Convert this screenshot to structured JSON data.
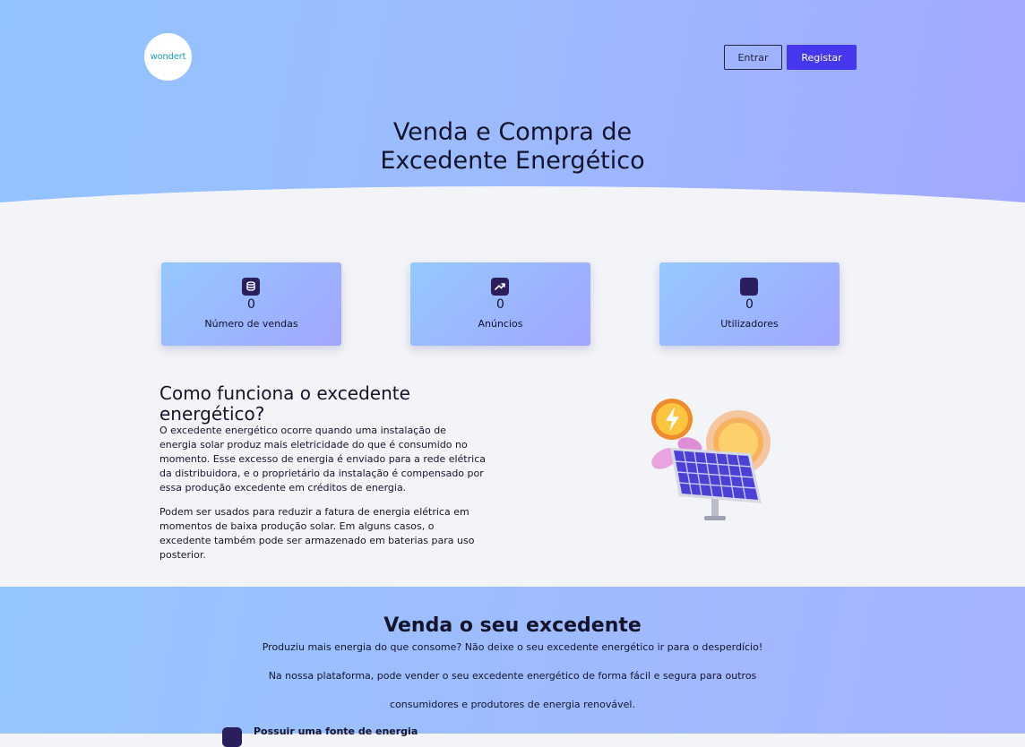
{
  "header": {
    "logo_text": "wondert",
    "login_label": "Entrar",
    "register_label": "Registar"
  },
  "hero": {
    "title_line1": "Venda e Compra de",
    "title_line2": "Excedente Energético"
  },
  "stats": [
    {
      "icon": "coins-icon",
      "value": "0",
      "label": "Número de vendas"
    },
    {
      "icon": "trending-up-icon",
      "value": "0",
      "label": "Anúncios"
    },
    {
      "icon": "users-icon",
      "value": "0",
      "label": "Utilizadores"
    }
  ],
  "how": {
    "title": "Como funciona o excedente energético?",
    "paragraph1": "O excedente energético ocorre quando uma instalação de energia solar produz mais eletricidade do que é consumido no momento. Esse excesso de energia é enviado para a rede elétrica da distribuidora, e o proprietário da instalação é compensado por essa produção excedente em créditos de energia.",
    "paragraph2": "Podem ser usados para reduzir a fatura de energia elétrica em momentos de baixa produção solar. Em alguns casos, o excedente também pode ser armazenado em baterias para uso posterior."
  },
  "sell": {
    "title": "Venda o seu excedente",
    "line1": "Produziu mais energia do que consome? Não deixe o seu excedente energético ir para o desperdício!",
    "line2": "Na nossa plataforma, pode vender o seu excedente energético de forma fácil e segura para outros",
    "line3": "consumidores e produtores de energia renovável.",
    "requirement1": "Possuir uma fonte de energia"
  },
  "colors": {
    "accent": "#4537ee",
    "icon_bg": "#2a1f5c"
  }
}
